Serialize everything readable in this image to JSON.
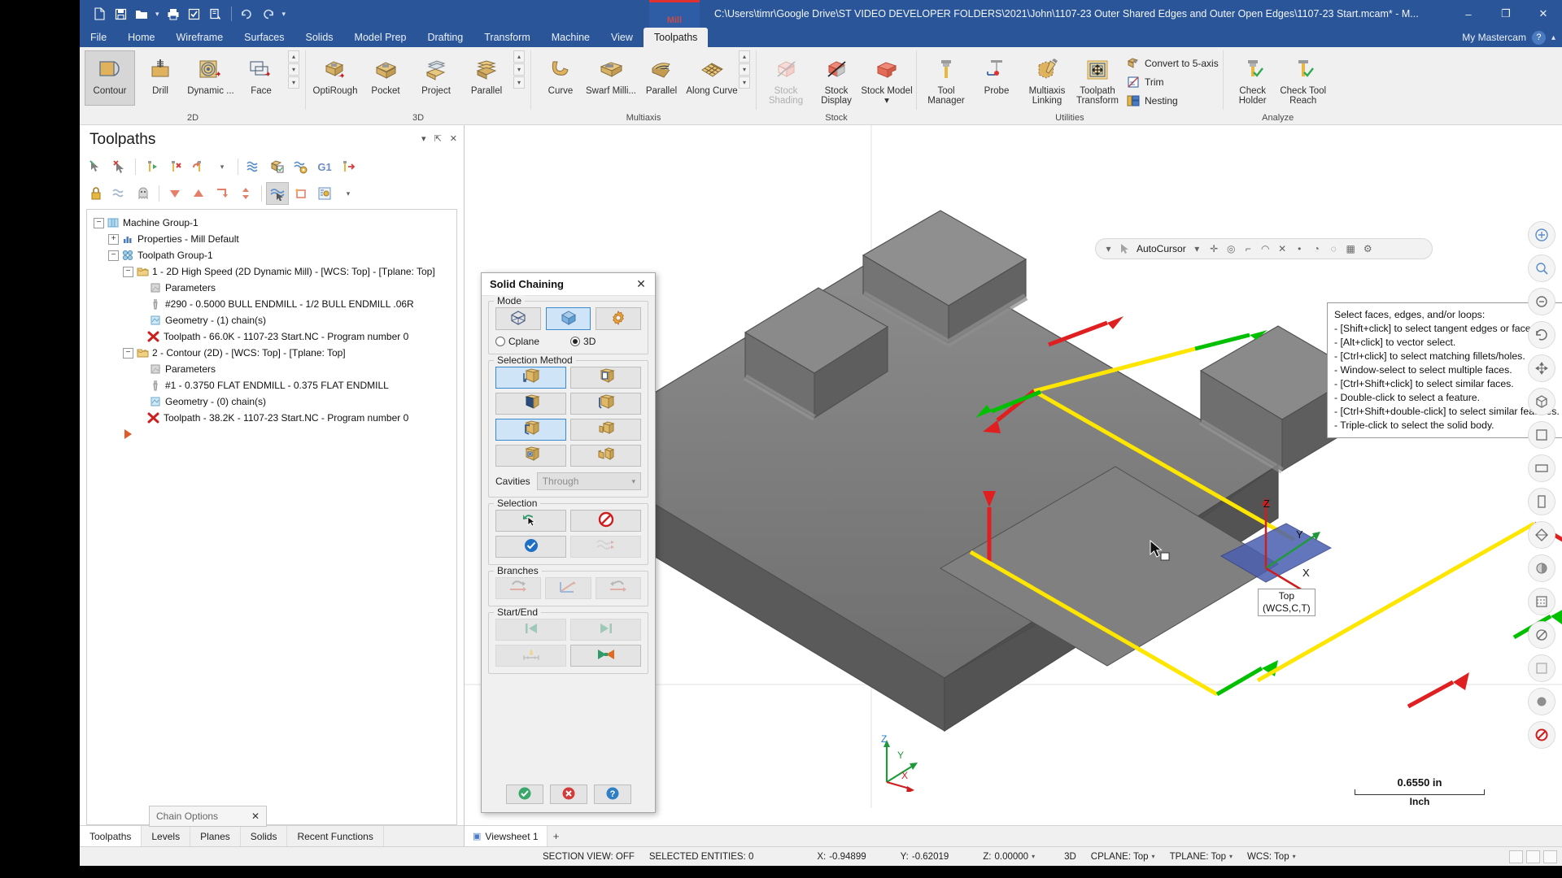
{
  "window": {
    "title": "C:\\Users\\timr\\Google Drive\\ST VIDEO DEVELOPER FOLDERS\\2021\\John\\1107-23 Outer Shared Edges and Outer Open Edges\\1107-23 Start.mcam* - M...",
    "product_tag": "Mill",
    "minimize": "–",
    "restore": "❐",
    "close": "✕"
  },
  "quick_access": {
    "items": [
      {
        "name": "new-file-icon",
        "glyph": "⬚"
      },
      {
        "name": "save-icon",
        "glyph": "💾"
      },
      {
        "name": "open-file-icon",
        "glyph": "📁"
      },
      {
        "name": "print-icon",
        "glyph": "🖨"
      },
      {
        "name": "print-preview-icon",
        "glyph": "☑"
      },
      {
        "name": "zoom-window-icon",
        "glyph": "🔎"
      },
      {
        "name": "undo-icon",
        "glyph": "↶"
      },
      {
        "name": "redo-icon",
        "glyph": "↷"
      },
      {
        "name": "customize-qat-icon",
        "glyph": "▾"
      }
    ]
  },
  "menu": {
    "items": [
      {
        "label": "File",
        "active": false
      },
      {
        "label": "Home",
        "active": false
      },
      {
        "label": "Wireframe",
        "active": false
      },
      {
        "label": "Surfaces",
        "active": false
      },
      {
        "label": "Solids",
        "active": false
      },
      {
        "label": "Model Prep",
        "active": false
      },
      {
        "label": "Drafting",
        "active": false
      },
      {
        "label": "Transform",
        "active": false
      },
      {
        "label": "Machine",
        "active": false
      },
      {
        "label": "View",
        "active": false
      },
      {
        "label": "Toolpaths",
        "active": true
      }
    ],
    "user_label": "My Mastercam",
    "help_glyph": "?"
  },
  "ribbon": {
    "groups": [
      {
        "label": "2D",
        "buttons": [
          {
            "label": "Contour",
            "icon": "contour-icon",
            "selected": true,
            "disabled": false
          },
          {
            "label": "Drill",
            "icon": "drill-icon",
            "selected": false,
            "disabled": false
          },
          {
            "label": "Dynamic ...",
            "icon": "dynamic-mill-icon",
            "selected": false,
            "disabled": false
          },
          {
            "label": "Face",
            "icon": "face-icon",
            "selected": false,
            "disabled": false
          }
        ],
        "has_scroller": true
      },
      {
        "label": "3D",
        "buttons": [
          {
            "label": "OptiRough",
            "icon": "optirough-icon",
            "selected": false,
            "disabled": false
          },
          {
            "label": "Pocket",
            "icon": "pocket-icon",
            "selected": false,
            "disabled": false
          },
          {
            "label": "Project",
            "icon": "project-icon",
            "selected": false,
            "disabled": false
          },
          {
            "label": "Parallel",
            "icon": "parallel-3d-icon",
            "selected": false,
            "disabled": false
          }
        ],
        "has_scroller": true
      },
      {
        "label": "Multiaxis",
        "buttons": [
          {
            "label": "Curve",
            "icon": "curve-icon",
            "selected": false,
            "disabled": false
          },
          {
            "label": "Swarf Milli...",
            "icon": "swarf-milling-icon",
            "selected": false,
            "disabled": false
          },
          {
            "label": "Parallel",
            "icon": "parallel-multiaxis-icon",
            "selected": false,
            "disabled": false
          },
          {
            "label": "Along Curve",
            "icon": "along-curve-icon",
            "selected": false,
            "disabled": false
          }
        ],
        "has_scroller": true
      },
      {
        "label": "Stock",
        "buttons": [
          {
            "label": "Stock Shading",
            "icon": "stock-shading-icon",
            "selected": false,
            "disabled": true
          },
          {
            "label": "Stock Display",
            "icon": "stock-display-icon",
            "selected": false,
            "disabled": false
          },
          {
            "label": "Stock Model ▾",
            "icon": "stock-model-icon",
            "selected": false,
            "disabled": false
          }
        ],
        "has_scroller": false
      },
      {
        "label": "Utilities",
        "buttons": [
          {
            "label": "Tool Manager",
            "icon": "tool-manager-icon",
            "selected": false,
            "disabled": false
          },
          {
            "label": "Probe",
            "icon": "probe-icon",
            "selected": false,
            "disabled": false
          },
          {
            "label": "Multiaxis Linking",
            "icon": "multiaxis-linking-icon",
            "selected": false,
            "disabled": false
          },
          {
            "label": "Toolpath Transform",
            "icon": "toolpath-transform-icon",
            "selected": false,
            "disabled": false
          }
        ],
        "small_buttons": [
          {
            "label": "Convert to 5-axis",
            "icon": "convert-5axis-icon"
          },
          {
            "label": "Trim",
            "icon": "trim-icon"
          },
          {
            "label": "Nesting",
            "icon": "nesting-icon"
          }
        ],
        "has_scroller": false
      },
      {
        "label": "Analyze",
        "buttons": [
          {
            "label": "Check Holder",
            "icon": "check-holder-icon",
            "selected": false,
            "disabled": false
          },
          {
            "label": "Check Tool Reach",
            "icon": "check-tool-reach-icon",
            "selected": false,
            "disabled": false
          }
        ],
        "has_scroller": false
      }
    ]
  },
  "toolpaths_panel": {
    "title": "Toolpaths",
    "header_controls": [
      {
        "name": "panel-dropdown-icon",
        "glyph": "▾"
      },
      {
        "name": "panel-pin-icon",
        "glyph": "⚓"
      },
      {
        "name": "panel-close-icon",
        "glyph": "✕"
      }
    ],
    "toolbar_row1": [
      {
        "name": "select-all-toolpaths-icon",
        "glyph": "➤",
        "active": false
      },
      {
        "name": "deselect-all-toolpaths-icon",
        "glyph": "✖",
        "active": false
      },
      {
        "name": "regenerate-selected-icon",
        "glyph": "▶",
        "active": false
      },
      {
        "name": "regenerate-invalid-icon",
        "glyph": "✗",
        "active": false
      },
      {
        "name": "regenerate-dirty-icon",
        "glyph": "↻",
        "active": false
      },
      {
        "name": "regenerate-dropdown-icon",
        "glyph": "▾",
        "active": false
      },
      {
        "name": "backplot-icon",
        "glyph": "≈",
        "active": false
      },
      {
        "name": "verify-icon",
        "glyph": "📦",
        "active": false
      },
      {
        "name": "simulate-icon",
        "glyph": "≈",
        "active": false
      },
      {
        "name": "g1-post-icon",
        "glyph": "G1",
        "active": false
      },
      {
        "name": "post-selected-icon",
        "glyph": "➡",
        "active": false
      }
    ],
    "toolbar_row2": [
      {
        "name": "lock-toolpath-icon",
        "glyph": "🔒",
        "active": false
      },
      {
        "name": "toggle-posting-icon",
        "glyph": "≈",
        "active": false
      },
      {
        "name": "toggle-display-icon",
        "glyph": "👻",
        "active": false
      },
      {
        "name": "move-down-icon",
        "glyph": "▼",
        "active": false
      },
      {
        "name": "move-up-icon",
        "glyph": "▲",
        "active": false
      },
      {
        "name": "move-insert-icon",
        "glyph": "↳",
        "active": false
      },
      {
        "name": "move-updown-icon",
        "glyph": "↕",
        "active": false
      },
      {
        "name": "only-selected-icon",
        "glyph": "➶",
        "active": true
      },
      {
        "name": "geometry-view-icon",
        "glyph": "□",
        "active": false
      },
      {
        "name": "toolpath-options-icon",
        "glyph": "⚙",
        "active": false
      },
      {
        "name": "options-dropdown-icon",
        "glyph": "▾",
        "active": false
      }
    ],
    "tree": [
      {
        "depth": 0,
        "expander": "-",
        "icon": "machine-group-icon",
        "label": "Machine Group-1"
      },
      {
        "depth": 1,
        "expander": "+",
        "icon": "properties-icon",
        "label": "Properties - Mill Default"
      },
      {
        "depth": 1,
        "expander": "-",
        "icon": "toolpath-group-icon",
        "label": "Toolpath Group-1"
      },
      {
        "depth": 2,
        "expander": "-",
        "icon": "toolpath-folder-icon",
        "label": "1 - 2D High Speed (2D Dynamic Mill) - [WCS: Top] - [Tplane: Top]"
      },
      {
        "depth": 3,
        "expander": "",
        "icon": "parameters-icon",
        "label": "Parameters"
      },
      {
        "depth": 3,
        "expander": "",
        "icon": "tool-icon",
        "label": "#290 - 0.5000 BULL ENDMILL - 1/2 BULL ENDMILL .06R"
      },
      {
        "depth": 3,
        "expander": "",
        "icon": "geometry-icon",
        "label": "Geometry - (1) chain(s)"
      },
      {
        "depth": 3,
        "expander": "",
        "icon": "toolpath-invalid-icon",
        "label": "Toolpath - 66.0K - 1107-23 Start.NC - Program number 0"
      },
      {
        "depth": 2,
        "expander": "-",
        "icon": "toolpath-folder-icon",
        "label": "2 - Contour (2D) - [WCS: Top] - [Tplane: Top]"
      },
      {
        "depth": 3,
        "expander": "",
        "icon": "parameters-icon",
        "label": "Parameters"
      },
      {
        "depth": 3,
        "expander": "",
        "icon": "tool-icon",
        "label": "#1 - 0.3750 FLAT ENDMILL - 0.375 FLAT ENDMILL"
      },
      {
        "depth": 3,
        "expander": "",
        "icon": "geometry-icon",
        "label": "Geometry - (0) chain(s)"
      },
      {
        "depth": 3,
        "expander": "",
        "icon": "toolpath-invalid-icon",
        "label": "Toolpath - 38.2K - 1107-23 Start.NC - Program number 0"
      },
      {
        "depth": 2,
        "expander": "",
        "icon": "insert-arrow-icon",
        "label": ""
      }
    ],
    "tabs": [
      {
        "label": "Toolpaths",
        "active": true
      },
      {
        "label": "Levels",
        "active": false
      },
      {
        "label": "Planes",
        "active": false
      },
      {
        "label": "Solids",
        "active": false
      },
      {
        "label": "Recent Functions",
        "active": false
      }
    ]
  },
  "autocursor": {
    "label": "AutoCursor",
    "items": [
      "autocursor-icon",
      "caret-icon",
      "origin-icon",
      "arc-center-icon",
      "endpoint-icon",
      "midpoint-icon",
      "intersection-icon",
      "point-icon",
      "quadrant-icon",
      "nearest-icon",
      "grid-icon",
      "settings-icon"
    ]
  },
  "hint": {
    "heading": "Select faces, edges, and/or loops:",
    "lines": [
      "- [Shift+click] to select tangent edges or faces.",
      "- [Alt+click] to vector select.",
      "- [Ctrl+click] to select matching fillets/holes.",
      "- Window-select to select multiple faces.",
      "- [Ctrl+Shift+click] to select similar faces.",
      "- Double-click to select a feature.",
      "- [Ctrl+Shift+double-click] to select similar features.",
      "- Triple-click to select the solid body."
    ]
  },
  "view_toolbar": [
    {
      "name": "fit-view-icon",
      "glyph": "⊕"
    },
    {
      "name": "zoom-window-icon",
      "glyph": "⌖"
    },
    {
      "name": "unzoom-icon",
      "glyph": "⊙"
    },
    {
      "name": "dynamic-rotate-icon",
      "glyph": "⟲"
    },
    {
      "name": "pan-icon",
      "glyph": "✛"
    },
    {
      "name": "isometric-view-icon",
      "glyph": "⬡"
    },
    {
      "name": "top-view-icon",
      "glyph": "□"
    },
    {
      "name": "front-view-icon",
      "glyph": "▭"
    },
    {
      "name": "right-view-icon",
      "glyph": "▯"
    },
    {
      "name": "wireframe-shading-icon",
      "glyph": "◈"
    },
    {
      "name": "shaded-view-icon",
      "glyph": "◉"
    },
    {
      "name": "hidden-lines-icon",
      "glyph": "▤"
    },
    {
      "name": "section-view-icon",
      "glyph": "⊘"
    },
    {
      "name": "blank-entities-icon",
      "glyph": "⬜"
    },
    {
      "name": "clear-colors-icon",
      "glyph": "⬤"
    },
    {
      "name": "no-entry-icon",
      "glyph": "⛔"
    }
  ],
  "viewport": {
    "plane_label_line1": "Top",
    "plane_label_line2": "(WCS,C,T)",
    "scale_value": "0.6550 in",
    "scale_units": "Inch",
    "axis_x": "X",
    "axis_y": "Y",
    "axis_z": "Z",
    "part_axis_x": "X",
    "part_axis_y": "Y",
    "part_axis_z": "Z",
    "tabs": [
      {
        "label": "Viewsheet 1",
        "active": true
      }
    ],
    "tab_add": "+"
  },
  "dialog": {
    "title": "Solid Chaining",
    "close_glyph": "✕",
    "mode": {
      "caption": "Mode",
      "buttons": [
        {
          "name": "wireframe-chaining-mode-button",
          "icon": "wireframe-cube-icon",
          "active": false
        },
        {
          "name": "solid-chaining-mode-button",
          "icon": "solid-cube-icon",
          "active": true
        },
        {
          "name": "chaining-settings-button",
          "icon": "gear-icon",
          "active": false
        }
      ],
      "radios": [
        {
          "label": "Cplane",
          "selected": false
        },
        {
          "label": "3D",
          "selected": true
        }
      ]
    },
    "selection_method": {
      "caption": "Selection Method",
      "buttons": [
        {
          "name": "select-edges-button",
          "icon": "cube-edge-icon",
          "active": true
        },
        {
          "name": "select-loops-button",
          "icon": "cube-loop-icon",
          "active": false
        },
        {
          "name": "select-faces-button",
          "icon": "cube-face-icon",
          "active": false
        },
        {
          "name": "select-open-edges-button",
          "icon": "cube-open-edge-icon",
          "active": false
        },
        {
          "name": "select-outer-shared-edges-button",
          "icon": "cube-outer-shared-icon",
          "active": true
        },
        {
          "name": "select-partial-loop-button",
          "icon": "cube-partial-loop-icon",
          "active": false
        },
        {
          "name": "select-cavity-button",
          "icon": "cube-cavity-icon",
          "active": false
        },
        {
          "name": "select-cavity-face-button",
          "icon": "cube-cavity-face-icon",
          "active": false
        }
      ],
      "cavities_label": "Cavities",
      "cavities_value": "Through"
    },
    "selection": {
      "caption": "Selection",
      "buttons": [
        {
          "name": "undo-last-selection-button",
          "icon": "undo-arrow-cursor-icon",
          "disabled": false
        },
        {
          "name": "clear-selection-button",
          "icon": "no-entry-icon",
          "disabled": false
        },
        {
          "name": "select-all-button",
          "icon": "blue-check-icon",
          "disabled": false
        },
        {
          "name": "reverse-chains-button",
          "icon": "wavy-lines-icon",
          "disabled": true
        }
      ]
    },
    "branches": {
      "caption": "Branches",
      "buttons": [
        {
          "name": "previous-branch-button",
          "icon": "branch-back-icon",
          "disabled": true
        },
        {
          "name": "change-branch-button",
          "icon": "branch-change-icon",
          "disabled": true
        },
        {
          "name": "next-branch-button",
          "icon": "branch-forward-icon",
          "disabled": true
        }
      ]
    },
    "start_end": {
      "caption": "Start/End",
      "buttons": [
        {
          "name": "move-start-backward-button",
          "icon": "skip-back-icon",
          "disabled": true
        },
        {
          "name": "move-end-forward-button",
          "icon": "skip-forward-icon",
          "disabled": true
        },
        {
          "name": "dynamic-start-end-button",
          "icon": "dynamic-point-icon",
          "disabled": true
        },
        {
          "name": "reverse-direction-button",
          "icon": "reverse-arrows-icon",
          "disabled": false
        }
      ]
    },
    "footer": [
      {
        "name": "ok-button",
        "icon": "green-check-icon"
      },
      {
        "name": "cancel-button",
        "icon": "red-x-icon"
      },
      {
        "name": "help-button",
        "icon": "blue-question-icon"
      }
    ]
  },
  "chain_options": {
    "label": "Chain Options",
    "close_glyph": "✕"
  },
  "statusbar": {
    "section_view": "SECTION VIEW: OFF",
    "selected_entities": "SELECTED ENTITIES: 0",
    "x_label": "X:",
    "x_value": "-0.94899",
    "y_label": "Y:",
    "y_value": "-0.62019",
    "z_label": "Z:",
    "z_value": "0.00000",
    "mode": "3D",
    "cplane": "CPLANE: Top",
    "tplane": "TPLANE: Top",
    "wcs": "WCS: Top",
    "caret": "▾"
  },
  "colors": {
    "title_blue": "#2a5699",
    "accent_blue": "#3a8ad0",
    "highlight_fill": "#cfe4f7",
    "chain_yellow": "#ffe600",
    "chain_green": "#00c000",
    "chain_red": "#e02020",
    "part_gray": "#7a7a7a",
    "panel_bg": "#f0f0f0"
  }
}
